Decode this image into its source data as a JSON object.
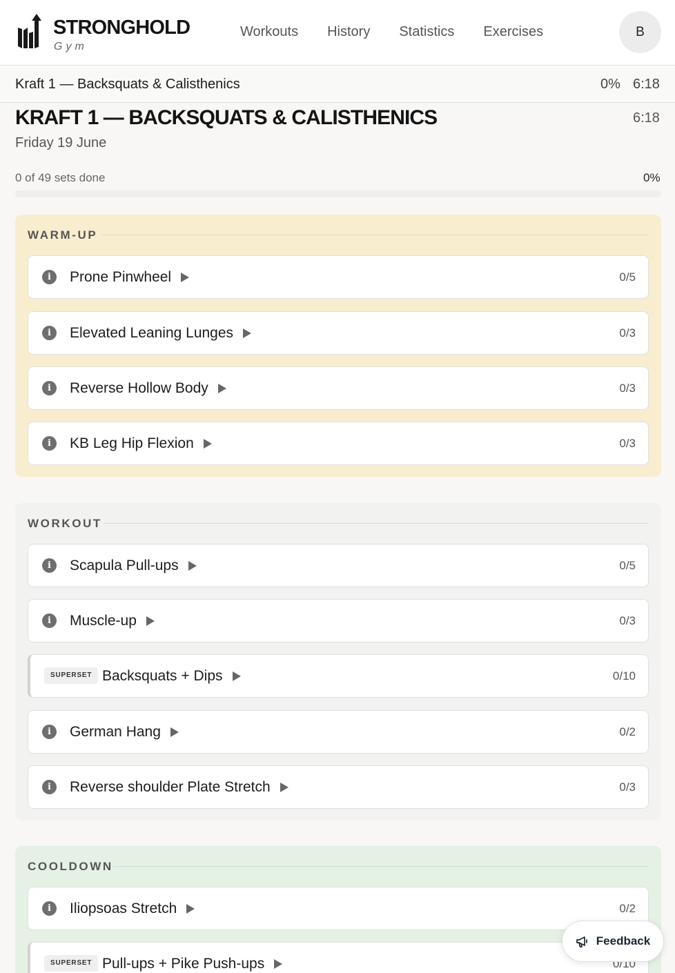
{
  "header": {
    "brand": "STRONGHOLD",
    "brand_sub": "Gym",
    "nav": [
      "Workouts",
      "History",
      "Statistics",
      "Exercises"
    ],
    "avatar_initial": "B"
  },
  "subbar": {
    "title": "Kraft 1 — Backsquats & Calisthenics",
    "percent": "0%",
    "time": "6:18"
  },
  "workout": {
    "title": "KRAFT 1 — BACKSQUATS & CALISTHENICS",
    "time": "6:18",
    "date": "Friday 19 June",
    "progress_text": "0 of 49 sets done",
    "progress_percent": "0%",
    "progress_fraction": 0
  },
  "sections": {
    "warmup": {
      "label": "WARM-UP",
      "items": [
        {
          "name": "Prone Pinwheel",
          "count": "0/5"
        },
        {
          "name": "Elevated Leaning Lunges",
          "count": "0/3"
        },
        {
          "name": "Reverse Hollow Body",
          "count": "0/3"
        },
        {
          "name": "KB Leg Hip Flexion",
          "count": "0/3"
        }
      ]
    },
    "workout": {
      "label": "WORKOUT",
      "items": [
        {
          "name": "Scapula Pull-ups",
          "count": "0/5"
        },
        {
          "name": "Muscle-up",
          "count": "0/3"
        },
        {
          "name": "Backsquats + Dips",
          "count": "0/10",
          "badge": "SUPERSET"
        },
        {
          "name": "German Hang",
          "count": "0/2"
        },
        {
          "name": "Reverse shoulder Plate Stretch",
          "count": "0/3"
        }
      ]
    },
    "cooldown": {
      "label": "COOLDOWN",
      "items": [
        {
          "name": "Iliopsoas Stretch",
          "count": "0/2"
        },
        {
          "name": "Pull-ups + Pike Push-ups",
          "count": "0/10",
          "badge": "SUPERSET"
        }
      ]
    }
  },
  "feedback": {
    "label": "Feedback"
  },
  "colors": {
    "warmup_bg": "#f8edce",
    "workout_bg": "#f2f2f0",
    "cooldown_bg": "#e4f1e4"
  }
}
